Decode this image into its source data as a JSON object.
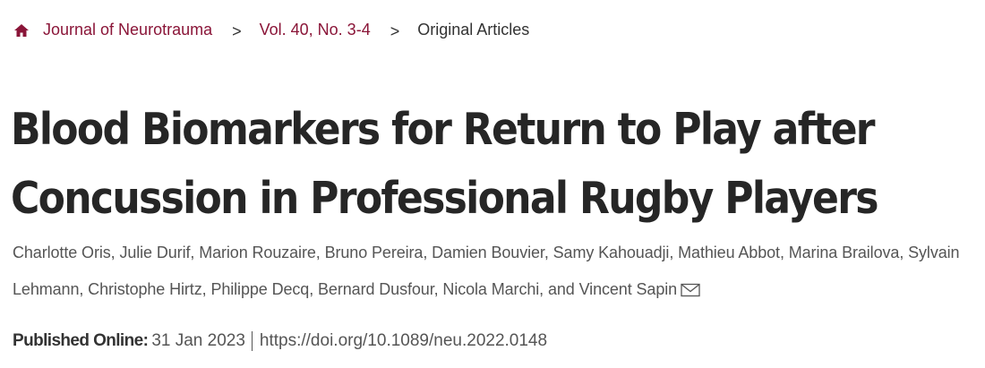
{
  "breadcrumb": {
    "home_label": "Journal of Neurotrauma",
    "separator": ">",
    "issue_label": "Vol. 40, No. 3-4",
    "current_label": "Original Articles",
    "home_icon": "home-icon"
  },
  "article": {
    "title": "Blood Biomarkers for Return to Play after Concussion in Professional Rugby Players",
    "authors": [
      "Charlotte Oris",
      "Julie Durif",
      "Marion Rouzaire",
      "Bruno Pereira",
      "Damien Bouvier",
      "Samy Kahouadji",
      "Mathieu Abbot",
      "Marina Brailova",
      "Sylvain Lehmann",
      "Christophe Hirtz",
      "Philippe Decq",
      "Bernard Dusfour",
      "Nicola Marchi",
      "Vincent Sapin"
    ],
    "author_separator": ", ",
    "final_joiner": ", and ",
    "corresponding_icon": "mail-icon",
    "published_label": "Published Online:",
    "published_date": "31 Jan 2023",
    "doi": "https://doi.org/10.1089/neu.2022.0148"
  },
  "colors": {
    "link": "#8a1538",
    "title": "#262626",
    "body_text": "#555555"
  }
}
